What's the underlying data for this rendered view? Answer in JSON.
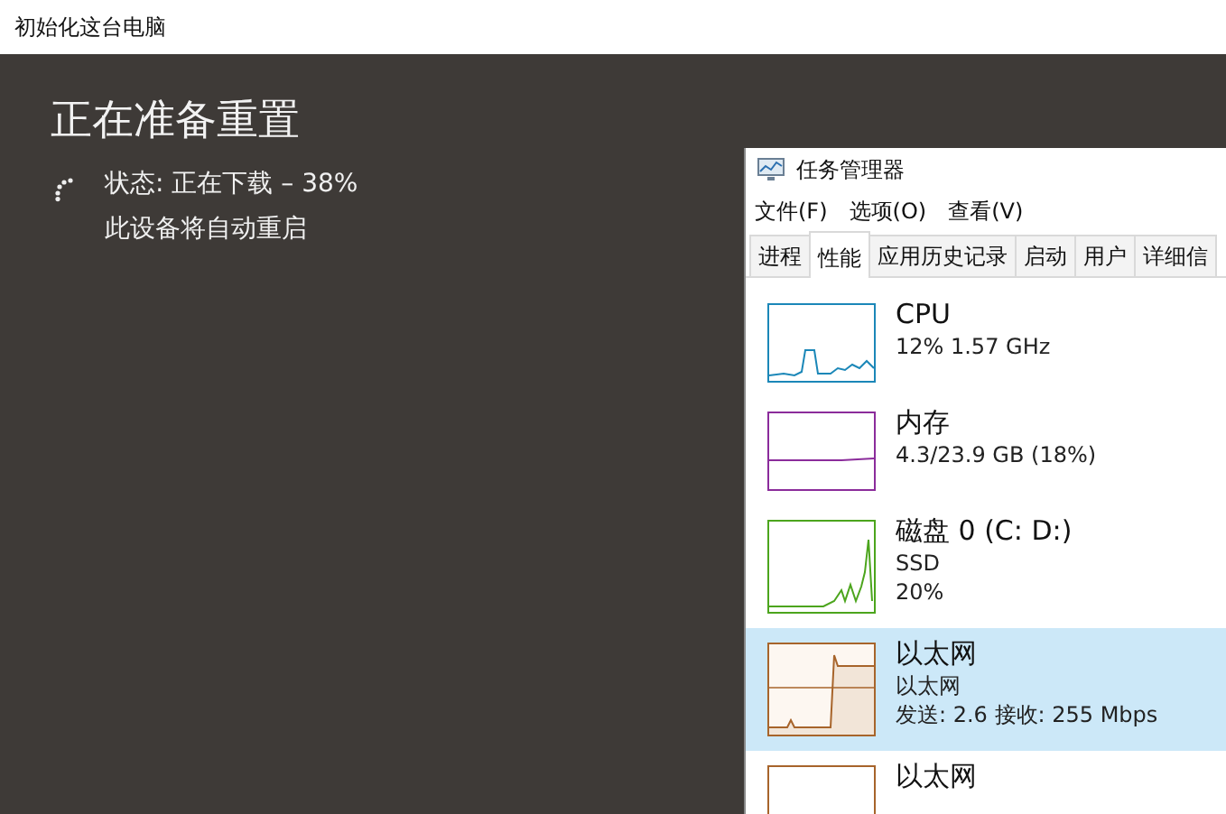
{
  "window": {
    "title": "初始化这台电脑"
  },
  "reset": {
    "heading": "正在准备重置",
    "status": "状态: 正在下载 – 38%",
    "note": "此设备将自动重启"
  },
  "task_manager": {
    "title": "任务管理器",
    "menu": [
      "文件(F)",
      "选项(O)",
      "查看(V)"
    ],
    "tabs": [
      {
        "label": "进程",
        "selected": false
      },
      {
        "label": "性能",
        "selected": true
      },
      {
        "label": "应用历史记录",
        "selected": false
      },
      {
        "label": "启动",
        "selected": false
      },
      {
        "label": "用户",
        "selected": false
      },
      {
        "label": "详细信",
        "selected": false
      }
    ],
    "items": [
      {
        "kind": "cpu",
        "name": "CPU",
        "lines": [
          "12% 1.57 GHz"
        ],
        "color": "#1b87b8",
        "selected": false
      },
      {
        "kind": "memory",
        "name": "内存",
        "lines": [
          "4.3/23.9 GB (18%)"
        ],
        "color": "#8b2c9b",
        "selected": false
      },
      {
        "kind": "disk",
        "name": "磁盘 0 (C: D:)",
        "lines": [
          "SSD",
          "20%"
        ],
        "color": "#4ca51d",
        "selected": false
      },
      {
        "kind": "ethernet",
        "name": "以太网",
        "lines": [
          "以太网",
          "发送: 2.6 接收: 255 Mbps"
        ],
        "color": "#a7642b",
        "selected": true
      },
      {
        "kind": "cut",
        "name": "以太网",
        "color": "#a7642b",
        "selected": false
      }
    ]
  }
}
